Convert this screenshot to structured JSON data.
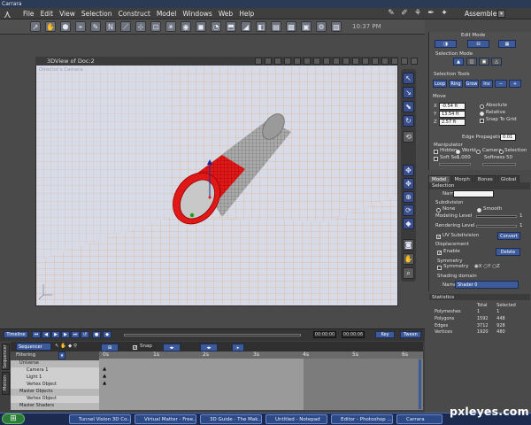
{
  "window": {
    "title": "Carrara"
  },
  "menu": {
    "items": [
      "File",
      "Edit",
      "View",
      "Selection",
      "Construct",
      "Model",
      "Windows",
      "Web",
      "Help"
    ]
  },
  "room": {
    "name": "Assemble"
  },
  "toolbar": {
    "clock": "10:37 PM"
  },
  "viewport": {
    "title": "3DView of Doc:2",
    "camera_label": "Director's Camera"
  },
  "panel": {
    "edit_mode": "Edit Mode",
    "selection_mode": "Selection Mode",
    "selection_tools": {
      "title": "Selection Tools",
      "buttons": [
        "Loop",
        "Ring",
        "Grow",
        "Inv"
      ]
    },
    "move": {
      "title": "Move",
      "fields": [
        {
          "axis": "X",
          "value": "-0.54 ft"
        },
        {
          "axis": "Y",
          "value": "13.54 ft"
        },
        {
          "axis": "Z",
          "value": "2.57 ft"
        }
      ],
      "options": [
        {
          "label": "Absolute",
          "checked": false
        },
        {
          "label": "Relative",
          "checked": true
        },
        {
          "label": "Snap To Grid",
          "checked": false
        }
      ]
    },
    "edge_propagation": {
      "label": "Edge Propagation",
      "value": "0.01"
    },
    "manipulator": {
      "title": "Manipulator",
      "options": [
        {
          "label": "Hidden",
          "checked": false
        },
        {
          "label": "World",
          "checked": true
        },
        {
          "label": "Camera",
          "checked": false
        },
        {
          "label": "Selection",
          "checked": false
        }
      ],
      "soft_sel": {
        "label": "Soft Sel.",
        "value": "1.000",
        "softness": "Softness",
        "softness_value": "50"
      }
    },
    "tabs": [
      {
        "label": "Model",
        "active": true
      },
      {
        "label": "Morph",
        "active": false
      },
      {
        "label": "Bones",
        "active": false
      },
      {
        "label": "Global",
        "active": false
      }
    ]
  },
  "model": {
    "selection": {
      "title": "Selection",
      "name_label": "Name",
      "name_value": ""
    },
    "subdivision": {
      "title": "Subdivision",
      "none": "None",
      "smooth": "Smooth",
      "smooth_selected": true,
      "modeling_level": {
        "label": "Modeling Level",
        "value": "1"
      },
      "rendering_level": {
        "label": "Rendering Level",
        "value": "1"
      },
      "uv_subdivision": {
        "label": "UV Subdivision",
        "checked": true
      },
      "convert_label": "Convert"
    },
    "displacement": {
      "title": "Displacement",
      "enable": "Enable",
      "enable_checked": true,
      "delete_label": "Delete"
    },
    "symmetry": {
      "title": "Symmetry",
      "label": "Symmetry",
      "checked": false
    },
    "shading_domain": {
      "title": "Shading domain",
      "name_label": "Name",
      "value": "Shader 0"
    }
  },
  "statistics": {
    "title": "Statistics",
    "headers": [
      "",
      "Total",
      "Selected"
    ],
    "rows": [
      [
        "Polymeshes",
        "1",
        "1"
      ],
      [
        "Polygons",
        "1592",
        "448"
      ],
      [
        "Edges",
        "3712",
        "928"
      ],
      [
        "Vertices",
        "1920",
        "480"
      ]
    ]
  },
  "timeline": {
    "panel_name": "Timeline",
    "current_time": "00:00:00",
    "end_time": "00:00:06",
    "sequencer": "Sequencer",
    "snap": "Snap",
    "filtering": "Filtering",
    "ticks": [
      "0s",
      "1s",
      "2s",
      "3s",
      "4s",
      "5s",
      "6s"
    ],
    "side_tabs": [
      "Sequencer",
      "Motion"
    ],
    "tree": [
      {
        "label": "Universe",
        "level": 0,
        "header": true
      },
      {
        "label": "Camera 1",
        "level": 1,
        "header": false
      },
      {
        "label": "Light 1",
        "level": 1,
        "header": false
      },
      {
        "label": "Vertex Object",
        "level": 1,
        "header": false
      },
      {
        "label": "Master Objects",
        "level": 0,
        "header": true
      },
      {
        "label": "Vertex Object",
        "level": 1,
        "header": false
      },
      {
        "label": "Master Shaders",
        "level": 0,
        "header": true
      }
    ],
    "key_label": "Key",
    "tween_label": "Tween"
  },
  "taskbar": {
    "items": [
      "Tunnel Vision 3D Co...",
      "Virtual Matter - Free...",
      "3D Guide - The Mak...",
      "Untitled - Notepad",
      "Editor - Photoshop ...",
      "Carrara"
    ]
  },
  "watermark": {
    "text": "pxleyes.com"
  },
  "colors": {
    "accent_blue": "#3d5a9a",
    "selection_red": "#e01818",
    "grid_orange": "#e8a060",
    "viewport_bg": "#d7dae7"
  }
}
